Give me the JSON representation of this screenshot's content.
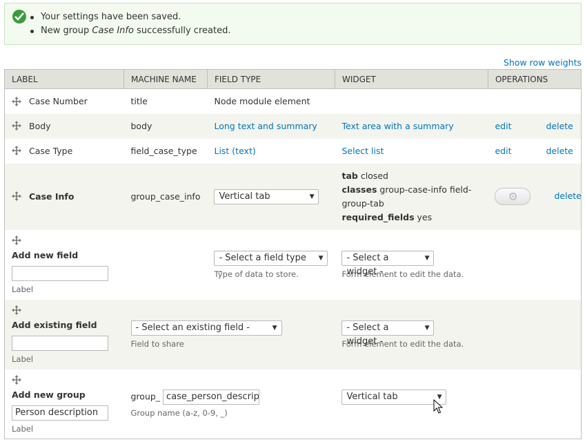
{
  "messages": {
    "status_icon": "checkmark-icon",
    "line1": "Your settings have been saved.",
    "line2_prefix": "New group ",
    "line2_group": "Case Info",
    "line2_suffix": " successfully created."
  },
  "show_row_weights": "Show row weights",
  "table": {
    "headers": [
      "LABEL",
      "MACHINE NAME",
      "FIELD TYPE",
      "WIDGET",
      "OPERATIONS"
    ],
    "rows": [
      {
        "label": "Case Number",
        "machine": "title",
        "type": "Node module element",
        "widget": ""
      },
      {
        "label": "Body",
        "machine": "body",
        "type": "Long text and summary",
        "widget": "Text area with a summary",
        "edit": "edit",
        "delete": "delete"
      },
      {
        "label": "Case Type",
        "machine": "field_case_type",
        "type": "List (text)",
        "widget": "Select list",
        "edit": "edit",
        "delete": "delete"
      }
    ],
    "group_row": {
      "label": "Case Info",
      "machine": "group_case_info",
      "type_select": "Vertical tab",
      "summary": {
        "tab_key": "tab",
        "tab_val": " closed",
        "classes_key": "classes",
        "classes_val": " group-case-info field-",
        "classes_val2": "group-tab",
        "required_key": "required_fields",
        "required_val": " yes"
      },
      "delete": "delete"
    },
    "add_new_field": {
      "title": "Add new field",
      "label_caption": "Label",
      "type_select": "- Select a field type -",
      "type_desc": "Type of data to store.",
      "widget_select": "- Select a widget -",
      "widget_desc": "Form element to edit the data."
    },
    "add_existing_field": {
      "title": "Add existing field",
      "label_caption": "Label",
      "field_select": "- Select an existing field -",
      "field_desc": "Field to share",
      "widget_select": "- Select a widget -",
      "widget_desc": "Form element to edit the data."
    },
    "add_new_group": {
      "title": "Add new group",
      "label_value": "Person description",
      "label_caption": "Label",
      "prefix": "group_",
      "name_value": "case_person_descriptio",
      "name_desc": "Group name (a-z, 0-9, _)",
      "widget_select": "Vertical tab"
    }
  },
  "colors": {
    "link": "#0074bd",
    "message_bg": "#f3faef",
    "header_bg": "#e1e2dc",
    "even_row": "#f3f4ee"
  }
}
